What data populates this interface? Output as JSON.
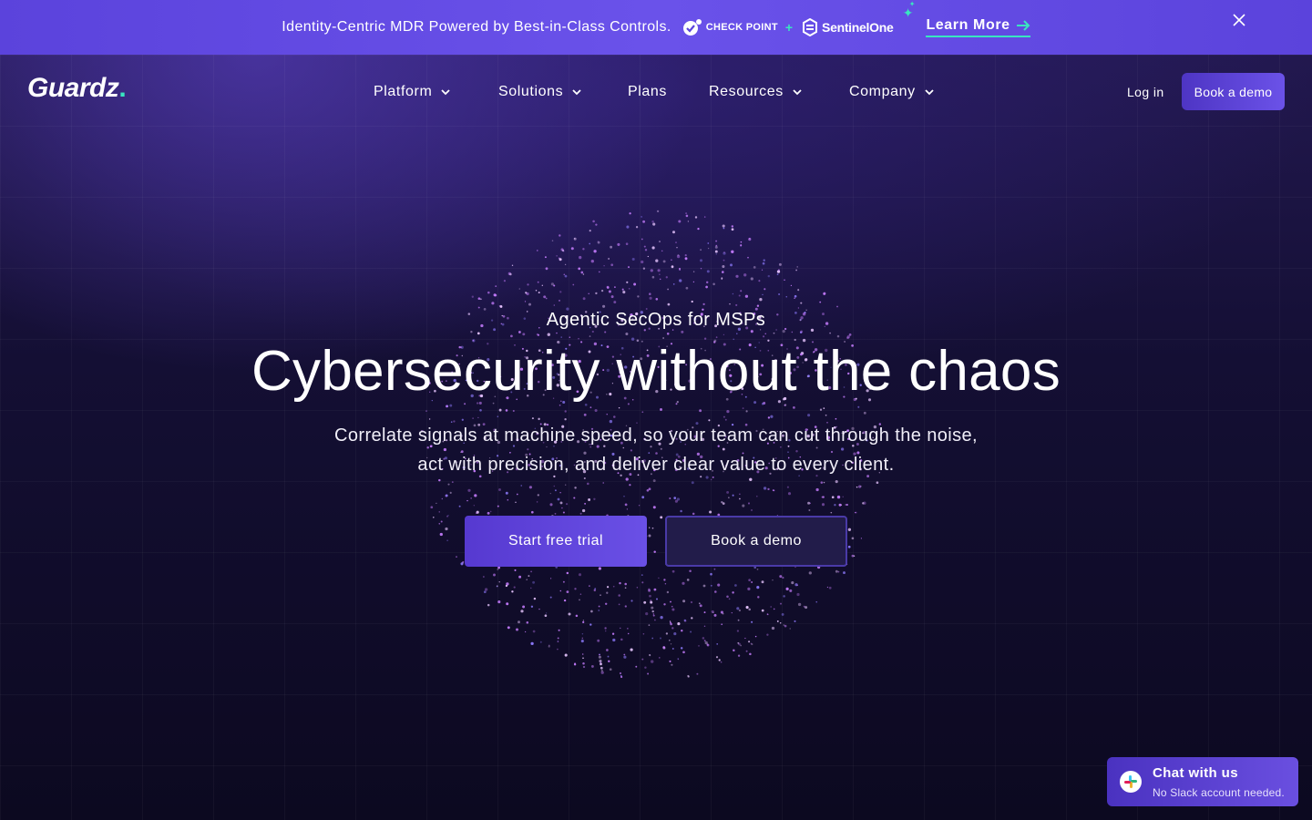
{
  "announcement": {
    "text": "Identity-Centric MDR Powered by Best-in-Class Controls.",
    "partner1": "CHECK POINT",
    "plus": "+",
    "partner2": "SentinelOne",
    "link_label": "Learn More",
    "link_icon": "arrow-right-icon",
    "close_icon": "close-icon"
  },
  "nav": {
    "logo": "Guardz",
    "items": [
      {
        "label": "Platform",
        "has_dropdown": true
      },
      {
        "label": "Solutions",
        "has_dropdown": true
      },
      {
        "label": "Plans",
        "has_dropdown": false
      },
      {
        "label": "Resources",
        "has_dropdown": true
      },
      {
        "label": "Company",
        "has_dropdown": true
      }
    ],
    "login_label": "Log in",
    "demo_label": "Book a demo"
  },
  "hero": {
    "eyebrow": "Agentic SecOps for MSPs",
    "headline": "Cybersecurity without the chaos",
    "subtext_line1": "Correlate signals at machine speed, so your team can cut through the noise,",
    "subtext_line2": "act with precision, and deliver clear value to every client.",
    "primary_cta": "Start free trial",
    "secondary_cta": "Book a demo"
  },
  "chat": {
    "title": "Chat with us",
    "subtitle": "No Slack account needed.",
    "icon": "slack-icon"
  },
  "colors": {
    "accent": "#39e6c0",
    "brand_purple": "#6a52ea",
    "background": "#0d0a1f"
  }
}
